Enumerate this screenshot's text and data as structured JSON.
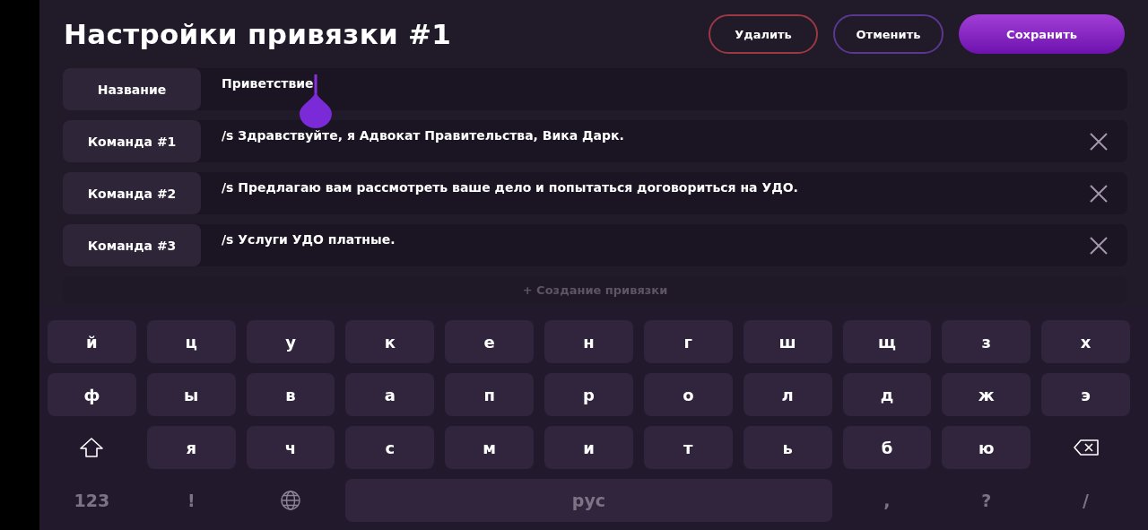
{
  "title": "Настройки привязки #1",
  "actions": [
    {
      "label": "Удалить",
      "kind": "danger"
    },
    {
      "label": "Отменить",
      "kind": "outline"
    },
    {
      "label": "Сохранить",
      "kind": "primary"
    }
  ],
  "fields": [
    {
      "label": "Название",
      "value": "Приветствие",
      "focused": true,
      "removable": false
    },
    {
      "label": "Команда #1",
      "value": "/s Здравствуйте, я Адвокат Правительства, Вика Дарк.",
      "focused": false,
      "removable": true
    },
    {
      "label": "Команда #2",
      "value": "/s Предлагаю вам рассмотреть ваше дело и попытаться договориться на УДО.",
      "focused": false,
      "removable": true
    },
    {
      "label": "Команда #3",
      "value": "/s Услуги УДО платные.",
      "focused": false,
      "removable": true
    }
  ],
  "add_button": {
    "label": "+ Создание привязки"
  },
  "keyboard": {
    "rows": [
      [
        {
          "kind": "letter",
          "label": "й"
        },
        {
          "kind": "letter",
          "label": "ц"
        },
        {
          "kind": "letter",
          "label": "у"
        },
        {
          "kind": "letter",
          "label": "к"
        },
        {
          "kind": "letter",
          "label": "е"
        },
        {
          "kind": "letter",
          "label": "н"
        },
        {
          "kind": "letter",
          "label": "г"
        },
        {
          "kind": "letter",
          "label": "ш"
        },
        {
          "kind": "letter",
          "label": "щ"
        },
        {
          "kind": "letter",
          "label": "з"
        },
        {
          "kind": "letter",
          "label": "х"
        }
      ],
      [
        {
          "kind": "letter",
          "label": "ф"
        },
        {
          "kind": "letter",
          "label": "ы"
        },
        {
          "kind": "letter",
          "label": "в"
        },
        {
          "kind": "letter",
          "label": "а"
        },
        {
          "kind": "letter",
          "label": "п"
        },
        {
          "kind": "letter",
          "label": "р"
        },
        {
          "kind": "letter",
          "label": "о"
        },
        {
          "kind": "letter",
          "label": "л"
        },
        {
          "kind": "letter",
          "label": "д"
        },
        {
          "kind": "letter",
          "label": "ж"
        },
        {
          "kind": "letter",
          "label": "э"
        }
      ],
      [
        {
          "kind": "shift"
        },
        {
          "kind": "letter",
          "label": "я"
        },
        {
          "kind": "letter",
          "label": "ч"
        },
        {
          "kind": "letter",
          "label": "с"
        },
        {
          "kind": "letter",
          "label": "м"
        },
        {
          "kind": "letter",
          "label": "и"
        },
        {
          "kind": "letter",
          "label": "т"
        },
        {
          "kind": "letter",
          "label": "ь"
        },
        {
          "kind": "letter",
          "label": "б"
        },
        {
          "kind": "letter",
          "label": "ю"
        },
        {
          "kind": "backspace"
        }
      ]
    ],
    "bottom_bar": [
      {
        "kind": "symbol",
        "label": "123"
      },
      {
        "kind": "symbol",
        "label": "!"
      },
      {
        "kind": "globe"
      },
      {
        "kind": "space",
        "label": "рус"
      },
      {
        "kind": "symbol",
        "label": ","
      },
      {
        "kind": "symbol",
        "label": "?"
      },
      {
        "kind": "symbol",
        "label": "/"
      }
    ]
  }
}
